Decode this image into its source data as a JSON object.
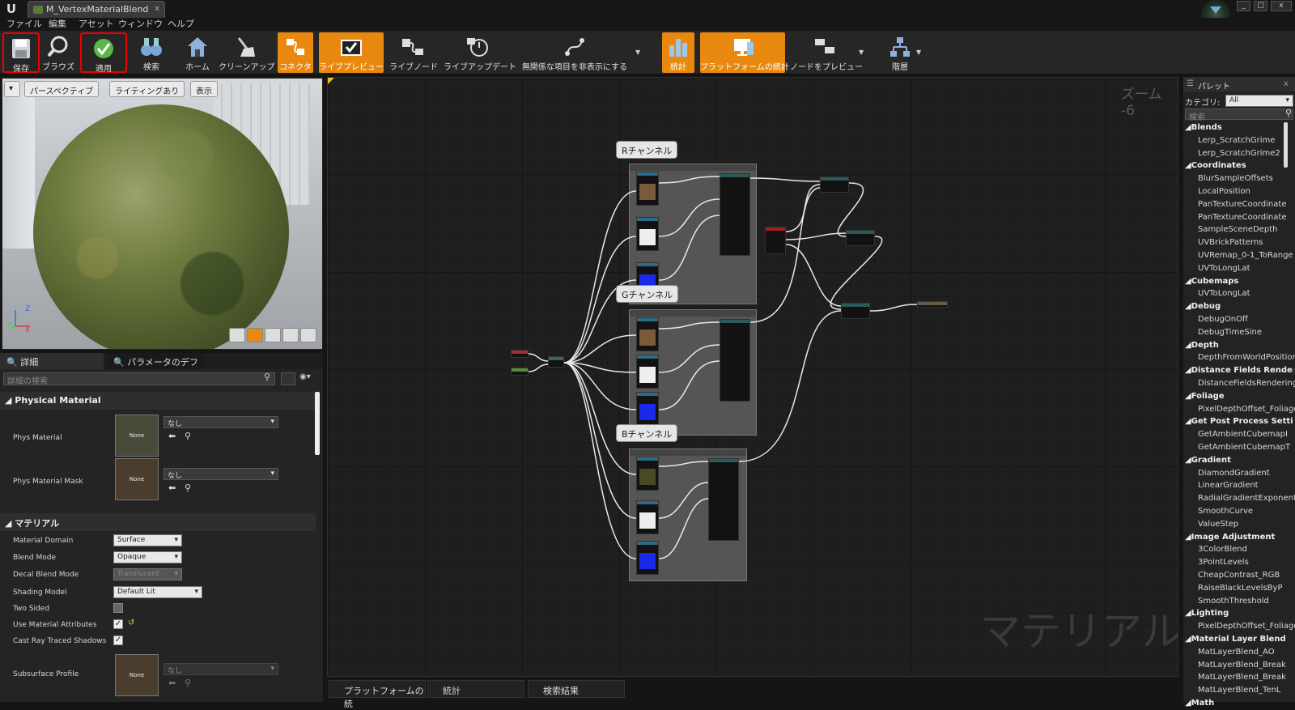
{
  "window": {
    "tab_title": "M_VertexMaterialBlend",
    "tab_close": "x",
    "logo": "U",
    "controls": [
      "_",
      "□",
      "x"
    ]
  },
  "menu": [
    "ファイル",
    "編集",
    "アセット",
    "ウィンドウ",
    "ヘルプ"
  ],
  "toolbar": {
    "save": "保存",
    "browse": "ブラウズ",
    "apply": "適用",
    "search": "検索",
    "home": "ホーム",
    "cleanup": "クリーンアップ",
    "connector": "コネクタ",
    "live_preview": "ライブプレビュー",
    "live_nodes": "ライブノード",
    "live_update": "ライブアップデート",
    "hide_unrelated": "無関係な項目を非表示にする",
    "stats": "統計",
    "platform_stats": "プラットフォームの統計",
    "preview_nodes": "ノードをプレビュー",
    "hierarchy": "階層"
  },
  "viewport": {
    "perspective": "パースペクティブ",
    "lighting": "ライティングあり",
    "show": "表示",
    "axis_z": "Z",
    "axis_y": "Y",
    "axis_x": "X"
  },
  "panel_tabs": {
    "details": "詳細",
    "param_defaults": "パラメータのデフォ/"
  },
  "details": {
    "search_placeholder": "詳細の検索",
    "physical_material": {
      "section": "Physical Material",
      "phys_material": "Phys Material",
      "phys_material_value": "なし",
      "phys_material_thumb": "None",
      "phys_material_mask": "Phys Material Mask",
      "phys_material_mask_value": "なし",
      "phys_material_mask_thumb": "None"
    },
    "material": {
      "section": "マテリアル",
      "material_domain": "Material Domain",
      "material_domain_value": "Surface",
      "blend_mode": "Blend Mode",
      "blend_mode_value": "Opaque",
      "decal_blend_mode": "Decal Blend Mode",
      "decal_blend_mode_value": "Translucent",
      "shading_model": "Shading Model",
      "shading_model_value": "Default Lit",
      "two_sided": "Two Sided",
      "two_sided_checked": false,
      "use_material_attributes": "Use Material Attributes",
      "use_material_attributes_checked": true,
      "cast_ray_traced_shadows": "Cast Ray Traced Shadows",
      "cast_ray_traced_shadows_checked": true,
      "subsurface_profile": "Subsurface Profile",
      "subsurface_profile_value": "なし",
      "subsurface_profile_thumb": "None"
    }
  },
  "graph": {
    "zoom": "ズーム -6",
    "watermark": "マテリアル",
    "comments": [
      "Rチャンネル",
      "Gチャンネル",
      "Bチャンネル"
    ]
  },
  "bottom_tabs": [
    "プラットフォームの統",
    "統計",
    "検索結果"
  ],
  "palette": {
    "title": "パレット",
    "close": "x",
    "category_label": "カテゴリ:",
    "category_value": "All",
    "search_placeholder": "検索",
    "items": [
      {
        "cat": "Blends"
      },
      {
        "item": "Lerp_ScratchGrime"
      },
      {
        "item": "Lerp_ScratchGrime2"
      },
      {
        "cat": "Coordinates"
      },
      {
        "item": "BlurSampleOffsets"
      },
      {
        "item": "LocalPosition"
      },
      {
        "item": "PanTextureCoordinate"
      },
      {
        "item": "PanTextureCoordinate"
      },
      {
        "item": "SampleSceneDepth"
      },
      {
        "item": "UVBrickPatterns"
      },
      {
        "item": "UVRemap_0-1_ToRange"
      },
      {
        "item": "UVToLongLat"
      },
      {
        "cat": "Cubemaps"
      },
      {
        "item": "UVToLongLat"
      },
      {
        "cat": "Debug"
      },
      {
        "item": "DebugOnOff"
      },
      {
        "item": "DebugTimeSine"
      },
      {
        "cat": "Depth"
      },
      {
        "item": "DepthFromWorldPosition"
      },
      {
        "cat": "Distance Fields Rendering"
      },
      {
        "item": "DistanceFieldsRendering"
      },
      {
        "cat": "Foliage"
      },
      {
        "item": "PixelDepthOffset_Foliage"
      },
      {
        "cat": "Get Post Process Settings"
      },
      {
        "item": "GetAmbientCubemapI"
      },
      {
        "item": "GetAmbientCubemapT"
      },
      {
        "cat": "Gradient"
      },
      {
        "item": "DiamondGradient"
      },
      {
        "item": "LinearGradient"
      },
      {
        "item": "RadialGradientExponential"
      },
      {
        "item": "SmoothCurve"
      },
      {
        "item": "ValueStep"
      },
      {
        "cat": "Image Adjustment"
      },
      {
        "item": "3ColorBlend"
      },
      {
        "item": "3PointLevels"
      },
      {
        "item": "CheapContrast_RGB"
      },
      {
        "item": "RaiseBlackLevelsByP"
      },
      {
        "item": "SmoothThreshold"
      },
      {
        "cat": "Lighting"
      },
      {
        "item": "PixelDepthOffset_Foliage"
      },
      {
        "cat": "Material Layer Blend"
      },
      {
        "item": "MatLayerBlend_AO"
      },
      {
        "item": "MatLayerBlend_Break"
      },
      {
        "item": "MatLayerBlend_Break"
      },
      {
        "item": "MatLayerBlend_TenL"
      },
      {
        "cat": "Math"
      }
    ]
  },
  "colors": {
    "accent": "#e8880f",
    "highlight_box": "#e00000",
    "graph_bg": "#1f1f1f"
  }
}
